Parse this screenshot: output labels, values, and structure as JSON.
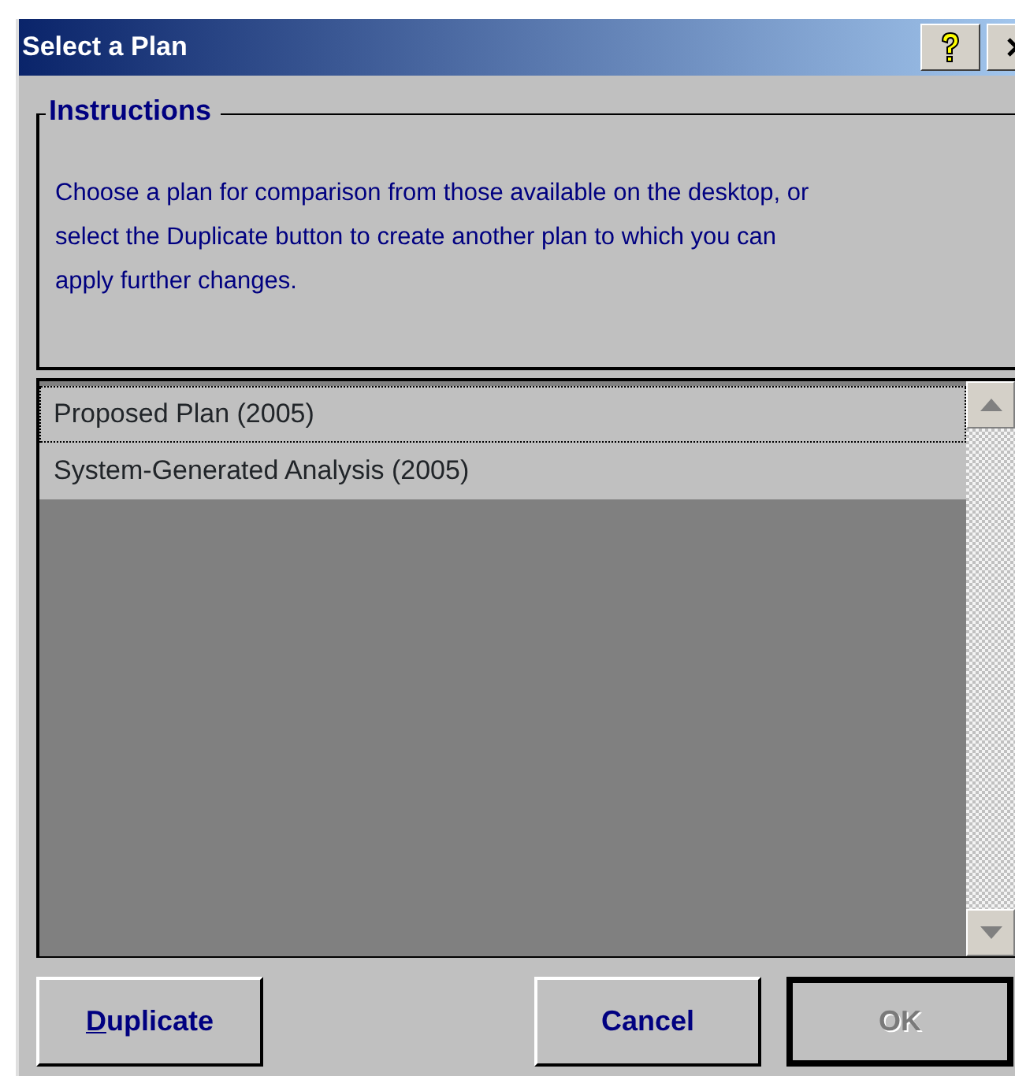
{
  "window": {
    "title": "Select a Plan"
  },
  "instructions": {
    "legend": "Instructions",
    "text": "Choose a plan for comparison from those available on the desktop, or select the Duplicate button to create another plan to which you can apply further changes."
  },
  "plans": [
    {
      "label": "Proposed Plan (2005)",
      "focused": true
    },
    {
      "label": "System-Generated Analysis (2005)",
      "focused": false
    }
  ],
  "buttons": [
    {
      "label": "Duplicate",
      "underline_first": true,
      "disabled": false,
      "default": false
    },
    {
      "label": "Cancel",
      "underline_first": false,
      "disabled": false,
      "default": false
    },
    {
      "label": "OK",
      "underline_first": false,
      "disabled": true,
      "default": true
    }
  ]
}
